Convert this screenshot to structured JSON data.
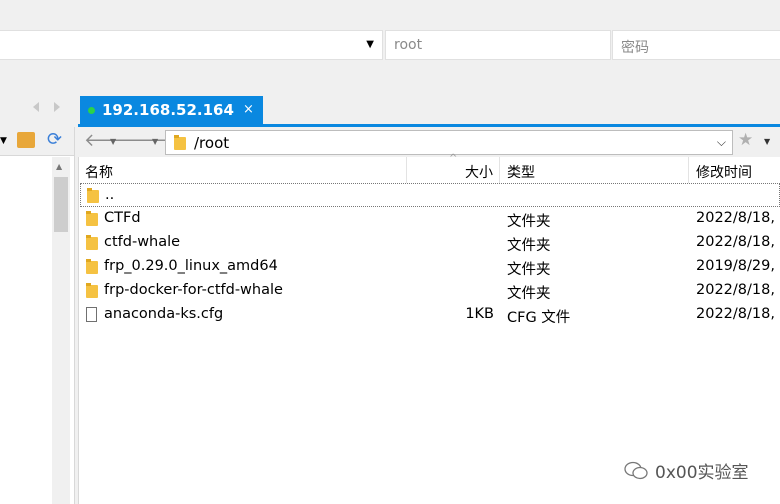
{
  "connection": {
    "username_placeholder": "root",
    "password_placeholder": "密码"
  },
  "tab": {
    "label": "192.168.52.164",
    "close": "×"
  },
  "path": {
    "value": "/root"
  },
  "columns": {
    "name": "名称",
    "size": "大小",
    "type": "类型",
    "modified": "修改时间"
  },
  "rows": [
    {
      "name": "..",
      "size": "",
      "type": "",
      "modified": "",
      "icon": "folder-icon"
    },
    {
      "name": "CTFd",
      "size": "",
      "type": "文件夹",
      "modified": "2022/8/18,",
      "icon": "folder-icon"
    },
    {
      "name": "ctfd-whale",
      "size": "",
      "type": "文件夹",
      "modified": "2022/8/18,",
      "icon": "folder-icon"
    },
    {
      "name": "frp_0.29.0_linux_amd64",
      "size": "",
      "type": "文件夹",
      "modified": "2019/8/29,",
      "icon": "folder-icon"
    },
    {
      "name": "frp-docker-for-ctfd-whale",
      "size": "",
      "type": "文件夹",
      "modified": "2022/8/18,",
      "icon": "folder-icon"
    },
    {
      "name": "anaconda-ks.cfg",
      "size": "1KB",
      "type": "CFG 文件",
      "modified": "2022/8/18,",
      "icon": "file-icon"
    }
  ],
  "watermark": {
    "text": "0x00实验室"
  },
  "colors": {
    "accent": "#0a88e0",
    "status_dot": "#2bd24a",
    "folder": "#f5c242"
  }
}
